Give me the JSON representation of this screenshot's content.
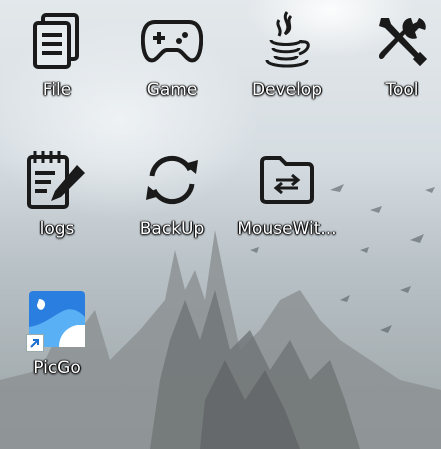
{
  "desktop": {
    "icons": [
      {
        "label": "File",
        "icon": "file-stack-icon"
      },
      {
        "label": "Game",
        "icon": "gamepad-icon"
      },
      {
        "label": "Develop",
        "icon": "java-coffee-icon"
      },
      {
        "label": "Tool",
        "icon": "tools-icon"
      },
      {
        "label": "logs",
        "icon": "notepad-pen-icon"
      },
      {
        "label": "BackUp",
        "icon": "sync-icon"
      },
      {
        "label": "MouseWit...",
        "icon": "folder-transfer-icon"
      },
      {
        "label": "PicGo",
        "icon": "picgo-app-icon",
        "shortcut": true
      }
    ]
  },
  "colors": {
    "glyph": "#1a1a1a",
    "picgo_blue": "#2a7ee0",
    "label_text": "#ffffff"
  }
}
